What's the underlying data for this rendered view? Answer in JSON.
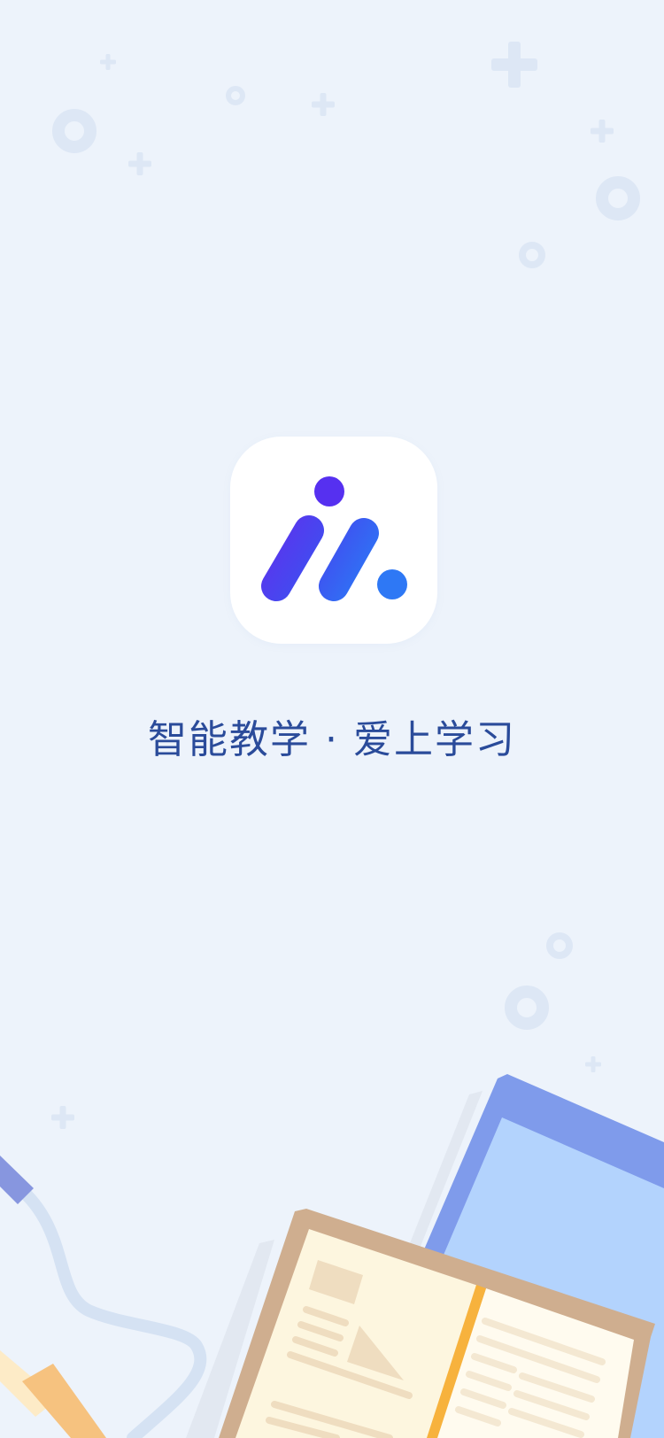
{
  "splash": {
    "slogan": "智能教学 · 爱上学习",
    "logo_icon": "app-logo-icon",
    "colors": {
      "background": "#EDF3FB",
      "slogan": "#2A4B9A",
      "logo_purple": "#5630F0",
      "logo_blue": "#2E78F5",
      "tile": "#FFFFFF"
    }
  }
}
